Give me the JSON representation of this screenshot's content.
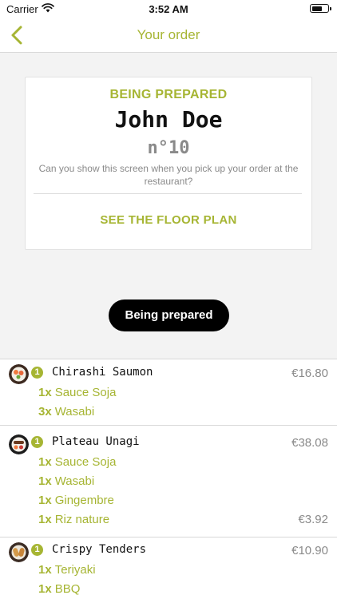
{
  "status_bar": {
    "carrier": "Carrier",
    "time": "3:52 AM"
  },
  "nav": {
    "title": "Your order",
    "back_icon": "chevron-left-icon"
  },
  "ticket": {
    "status": "BEING PREPARED",
    "name": "John Doe",
    "number": "n°10",
    "hint": "Can you show this screen when you pick up your order at the restaurant?",
    "floor_plan": "SEE THE FLOOR PLAN"
  },
  "status_pill": "Being prepared",
  "colors": {
    "accent": "#a6b533",
    "muted": "#8a8a8a",
    "pill": "#000000"
  },
  "items": [
    {
      "qty": "1",
      "name": "Chirashi Saumon",
      "price": "€16.80",
      "icon": "chirashi-dish-icon",
      "options": [
        {
          "qty": "1x",
          "name": "Sauce Soja",
          "price": ""
        },
        {
          "qty": "3x",
          "name": "Wasabi",
          "price": ""
        }
      ]
    },
    {
      "qty": "1",
      "name": "Plateau Unagi",
      "price": "€38.08",
      "icon": "unagi-dish-icon",
      "options": [
        {
          "qty": "1x",
          "name": "Sauce Soja",
          "price": ""
        },
        {
          "qty": "1x",
          "name": "Wasabi",
          "price": ""
        },
        {
          "qty": "1x",
          "name": "Gingembre",
          "price": ""
        },
        {
          "qty": "1x",
          "name": "Riz nature",
          "price": "€3.92"
        }
      ]
    },
    {
      "qty": "1",
      "name": "Crispy Tenders",
      "price": "€10.90",
      "icon": "tenders-dish-icon",
      "options": [
        {
          "qty": "1x",
          "name": "Teriyaki",
          "price": ""
        },
        {
          "qty": "1x",
          "name": "BBQ",
          "price": ""
        }
      ]
    }
  ]
}
